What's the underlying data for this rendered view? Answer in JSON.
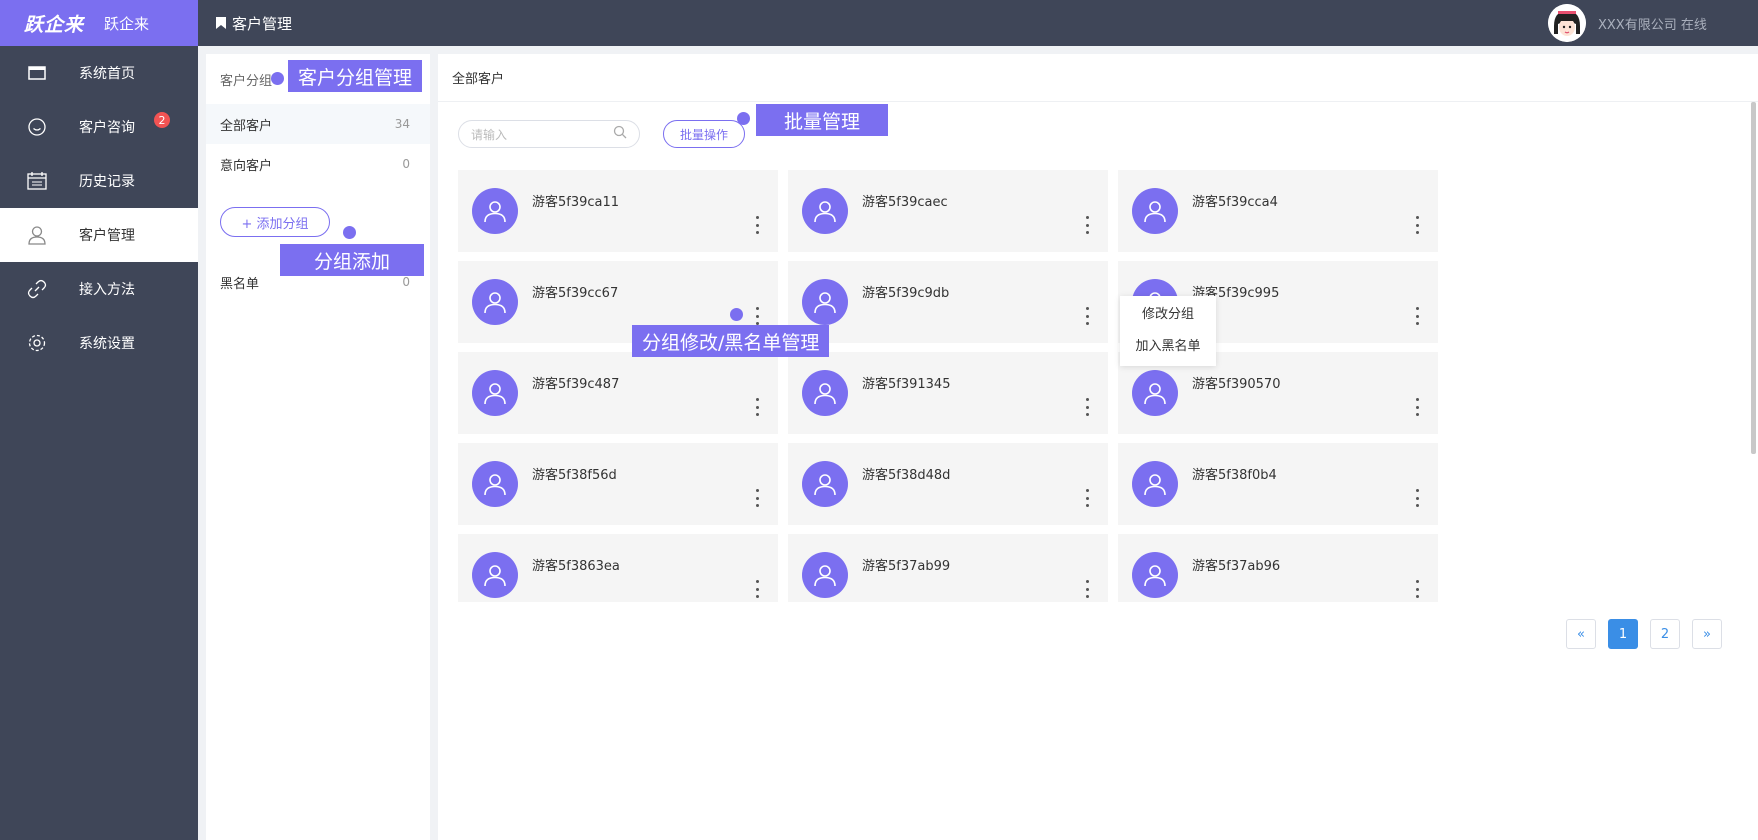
{
  "brand": {
    "logo_text": "跃企来",
    "name": "跃企来"
  },
  "sidebar": {
    "items": [
      {
        "label": "系统首页",
        "icon": "window-icon"
      },
      {
        "label": "客户咨询",
        "icon": "smiley-icon",
        "badge": "2"
      },
      {
        "label": "历史记录",
        "icon": "calendar-icon"
      },
      {
        "label": "客户管理",
        "icon": "user-icon",
        "active": true
      },
      {
        "label": "接入方法",
        "icon": "link-icon"
      },
      {
        "label": "系统设置",
        "icon": "gear-icon"
      }
    ]
  },
  "header": {
    "title": "客户管理",
    "status_text": "XXX有限公司 在线"
  },
  "groups": {
    "header": "客户分组",
    "items": [
      {
        "label": "全部客户",
        "count": "34"
      },
      {
        "label": "意向客户",
        "count": "0"
      }
    ],
    "add_button": "+ 添加分组",
    "blacklist": {
      "label": "黑名单",
      "count": "0"
    }
  },
  "main": {
    "title": "全部客户",
    "search_placeholder": "请输入",
    "batch_button": "批量操作",
    "customers": [
      "游客5f39ca11",
      "游客5f39caec",
      "游客5f39cca4",
      "游客5f39cc67",
      "游客5f39c9db",
      "游客5f39c995",
      "游客5f39c487",
      "游客5f391345",
      "游客5f390570",
      "游客5f38f56d",
      "游客5f38d48d",
      "游客5f38f0b4",
      "游客5f3863ea",
      "游客5f37ab99",
      "游客5f37ab96"
    ],
    "context_menu": [
      "修改分组",
      "加入黑名单"
    ]
  },
  "pagination": {
    "prev": "«",
    "pages": [
      "1",
      "2"
    ],
    "current": "1",
    "next": "»"
  },
  "annotations": {
    "group_manage": "客户分组管理",
    "batch_manage": "批量管理",
    "group_add": "分组添加",
    "group_edit_blacklist": "分组修改/黑名单管理"
  },
  "colors": {
    "accent": "#7b6ff0",
    "sidebar": "#3f4658",
    "badge": "#f25353",
    "pager_active": "#3a8ee6"
  }
}
